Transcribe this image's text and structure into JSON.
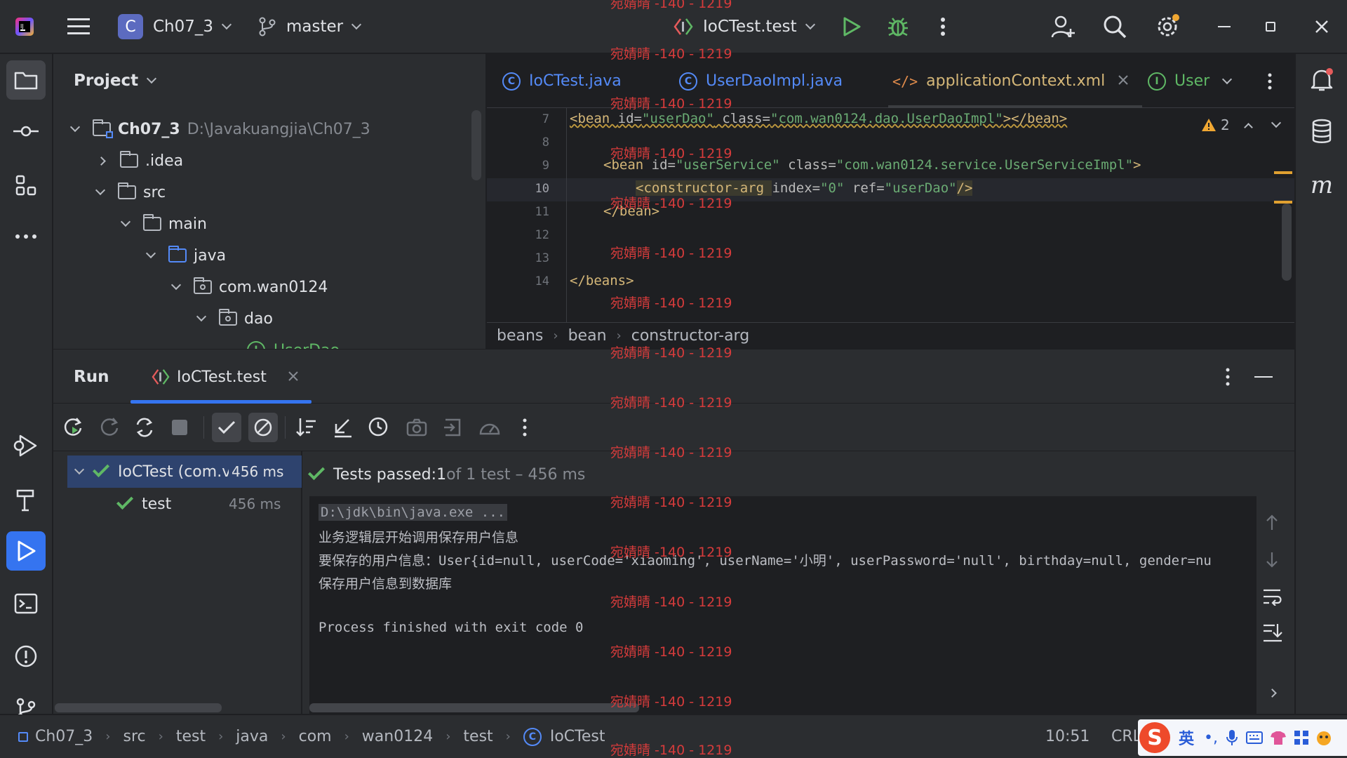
{
  "titlebar": {
    "project_badge": "C",
    "project_name": "Ch07_3",
    "branch": "master",
    "run_config": "IoCTest.test"
  },
  "project_panel": {
    "title": "Project",
    "tree": [
      {
        "label": "Ch07_3",
        "path": "D:\\Javakuangjia\\Ch07_3"
      },
      {
        "label": ".idea"
      },
      {
        "label": "src"
      },
      {
        "label": "main"
      },
      {
        "label": "java"
      },
      {
        "label": "com.wan0124"
      },
      {
        "label": "dao"
      },
      {
        "label": "UserDao"
      }
    ]
  },
  "editor": {
    "tabs": [
      {
        "label": "IoCTest.java",
        "icon": "C"
      },
      {
        "label": "UserDaoImpl.java",
        "icon": "C"
      },
      {
        "label": "applicationContext.xml",
        "icon": "</>"
      },
      {
        "label": "User",
        "icon": "I"
      }
    ],
    "warning_count": "2",
    "lines": [
      {
        "n": "7"
      },
      {
        "n": "8"
      },
      {
        "n": "9"
      },
      {
        "n": "10"
      },
      {
        "n": "11"
      },
      {
        "n": "12"
      },
      {
        "n": "13"
      },
      {
        "n": "14"
      }
    ],
    "code": {
      "l7_tag": "<bean ",
      "l7_a1": "id=",
      "l7_v1": "\"userDao\"",
      "l7_a2": " class=",
      "l7_v2": "\"com.wan0124.dao.UserDaoImpl\"",
      "l7_end": "></bean>",
      "l9_tag": "<bean ",
      "l9_a1": "id=",
      "l9_v1": "\"userService\"",
      "l9_a2": " class=",
      "l9_v2": "\"com.wan0124.service.UserServiceImpl\"",
      "l9_end": ">",
      "l10_tag": "<constructor-arg ",
      "l10_a1": "index=",
      "l10_v1": "\"0\"",
      "l10_a2": " ref=",
      "l10_v2": "\"userDao\"",
      "l10_end": "/>",
      "l11": "</bean>",
      "l14": "</beans>"
    },
    "breadcrumb": [
      "beans",
      "bean",
      "constructor-arg"
    ]
  },
  "run": {
    "title": "Run",
    "tab": "IoCTest.test",
    "tree": [
      {
        "label": "IoCTest (com.v",
        "time": "456 ms"
      },
      {
        "label": "test",
        "time": "456 ms"
      }
    ],
    "status_prefix": "Tests passed: ",
    "status_count": "1",
    "status_suffix": " of 1 test – 456 ms",
    "console": [
      "D:\\jdk\\bin\\java.exe ...",
      "业务逻辑层开始调用保存用户信息",
      "要保存的用户信息：User{id=null, userCode='xiaoming', userName='小明', userPassword='null', birthday=null, gender=nu",
      "保存用户信息到数据库",
      "",
      "Process finished with exit code 0"
    ]
  },
  "statusbar": {
    "path": [
      "Ch07_3",
      "src",
      "test",
      "java",
      "com",
      "wan0124",
      "test",
      "IoCTest"
    ],
    "position": "10:51",
    "line_ending": "CRL",
    "ime": "英"
  },
  "watermark": "宛婧晴 -140 - 1219",
  "colors": {
    "accent": "#3574f0",
    "success": "#5fb865",
    "xml_tag": "#d5b778",
    "xml_string": "#6aab73"
  }
}
